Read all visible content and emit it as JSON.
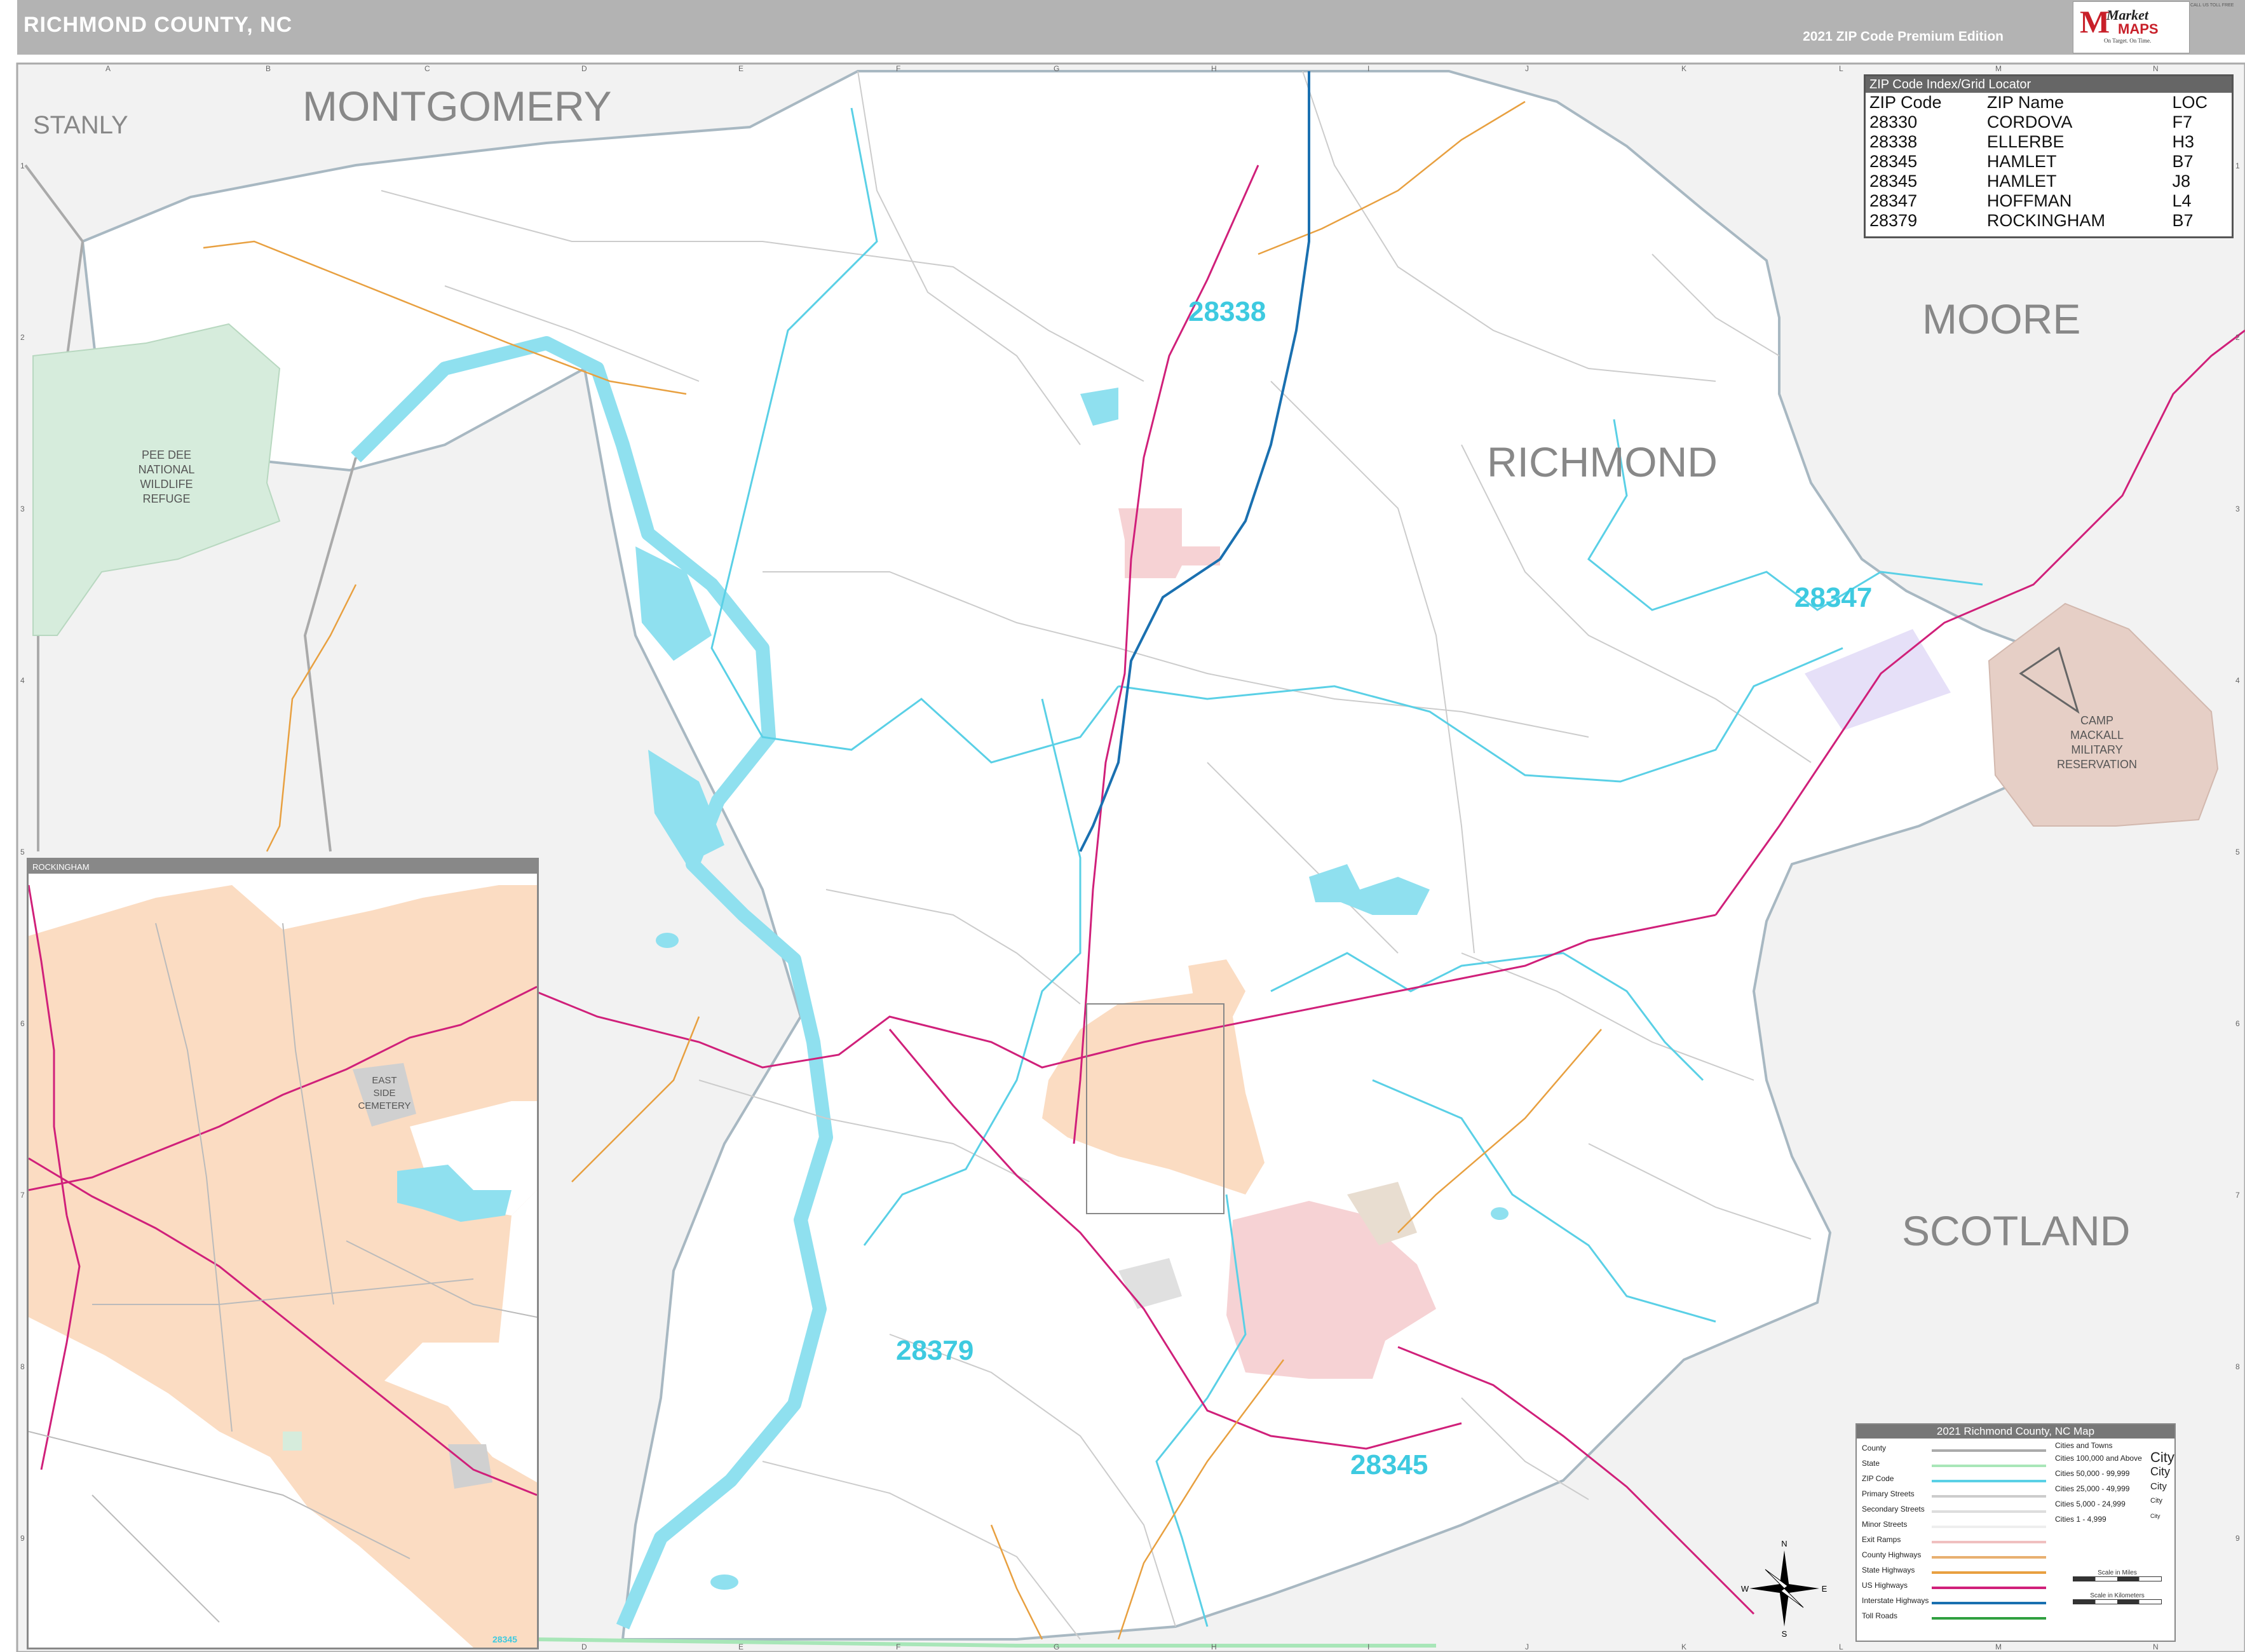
{
  "header": {
    "title": "RICHMOND COUNTY, NC",
    "edition": "2021 ZIP Code Premium Edition"
  },
  "logo": {
    "mark": "M",
    "brand1": "Market",
    "brand2": "MAPS",
    "tagline": "On Target. On Time.",
    "contact": "CALL US TOLL FREE"
  },
  "grid": {
    "columns": [
      "A",
      "B",
      "C",
      "D",
      "E",
      "F",
      "G",
      "H",
      "I",
      "J",
      "K",
      "L",
      "M",
      "N"
    ],
    "rows": [
      "1",
      "2",
      "3",
      "4",
      "5",
      "6",
      "7",
      "8",
      "9"
    ]
  },
  "regions": {
    "stanly": "STANLY",
    "montgomery": "MONTGOMERY",
    "moore": "MOORE",
    "richmond": "RICHMOND",
    "scotland": "SCOTLAND"
  },
  "parks": {
    "pee_dee": [
      "PEE DEE",
      "NATIONAL",
      "WILDLIFE",
      "REFUGE"
    ],
    "camp_mackall": [
      "CAMP",
      "MACKALL",
      "MILITARY",
      "RESERVATION"
    ]
  },
  "zip_labels": {
    "z28338": "28338",
    "z28347": "28347",
    "z28379": "28379",
    "z28345": "28345"
  },
  "zip_index": {
    "title": "ZIP Code Index/Grid Locator",
    "headers": [
      "ZIP Code",
      "ZIP Name",
      "LOC"
    ],
    "rows": [
      [
        "28330",
        "CORDOVA",
        "F7"
      ],
      [
        "28338",
        "ELLERBE",
        "H3"
      ],
      [
        "28345",
        "HAMLET",
        "B7"
      ],
      [
        "28345",
        "HAMLET",
        "J8"
      ],
      [
        "28347",
        "HOFFMAN",
        "L4"
      ],
      [
        "28379",
        "ROCKINGHAM",
        "B7"
      ]
    ]
  },
  "inset": {
    "label": "ROCKINGHAM",
    "cemetery": [
      "EAST",
      "SIDE",
      "CEMETERY"
    ],
    "zip": "28345"
  },
  "legend": {
    "title": "2021 Richmond County, NC Map",
    "items": [
      {
        "label": "County",
        "color": "#aaaaaa"
      },
      {
        "label": "State",
        "color": "#a8e6b8"
      },
      {
        "label": "ZIP Code",
        "color": "#5ad0e6"
      },
      {
        "label": "Primary Streets",
        "color": "#cccccc"
      },
      {
        "label": "Secondary Streets",
        "color": "#dddddd"
      },
      {
        "label": "Minor Streets",
        "color": "#eeeeee"
      },
      {
        "label": "Exit Ramps",
        "color": "#f0c0c0"
      },
      {
        "label": "County Highways",
        "color": "#e8b070"
      },
      {
        "label": "State Highways",
        "color": "#e8a040"
      },
      {
        "label": "US Highways",
        "color": "#d0207a"
      },
      {
        "label": "Interstate Highways",
        "color": "#1a70b0"
      },
      {
        "label": "Toll Roads",
        "color": "#30a040"
      }
    ],
    "cities_title": "Cities and Towns",
    "cities": [
      {
        "range": "Cities 100,000 and Above",
        "sample": "City"
      },
      {
        "range": "Cities 50,000 - 99,999",
        "sample": "City"
      },
      {
        "range": "Cities 25,000 - 49,999",
        "sample": "City"
      },
      {
        "range": "Cities 5,000 - 24,999",
        "sample": "City"
      },
      {
        "range": "Cities 1 - 4,999",
        "sample": "City"
      }
    ],
    "scale_miles": "Scale in Miles",
    "scale_km": "Scale in Kilometers"
  },
  "compass": {
    "n": "N",
    "s": "S",
    "e": "E",
    "w": "W"
  }
}
